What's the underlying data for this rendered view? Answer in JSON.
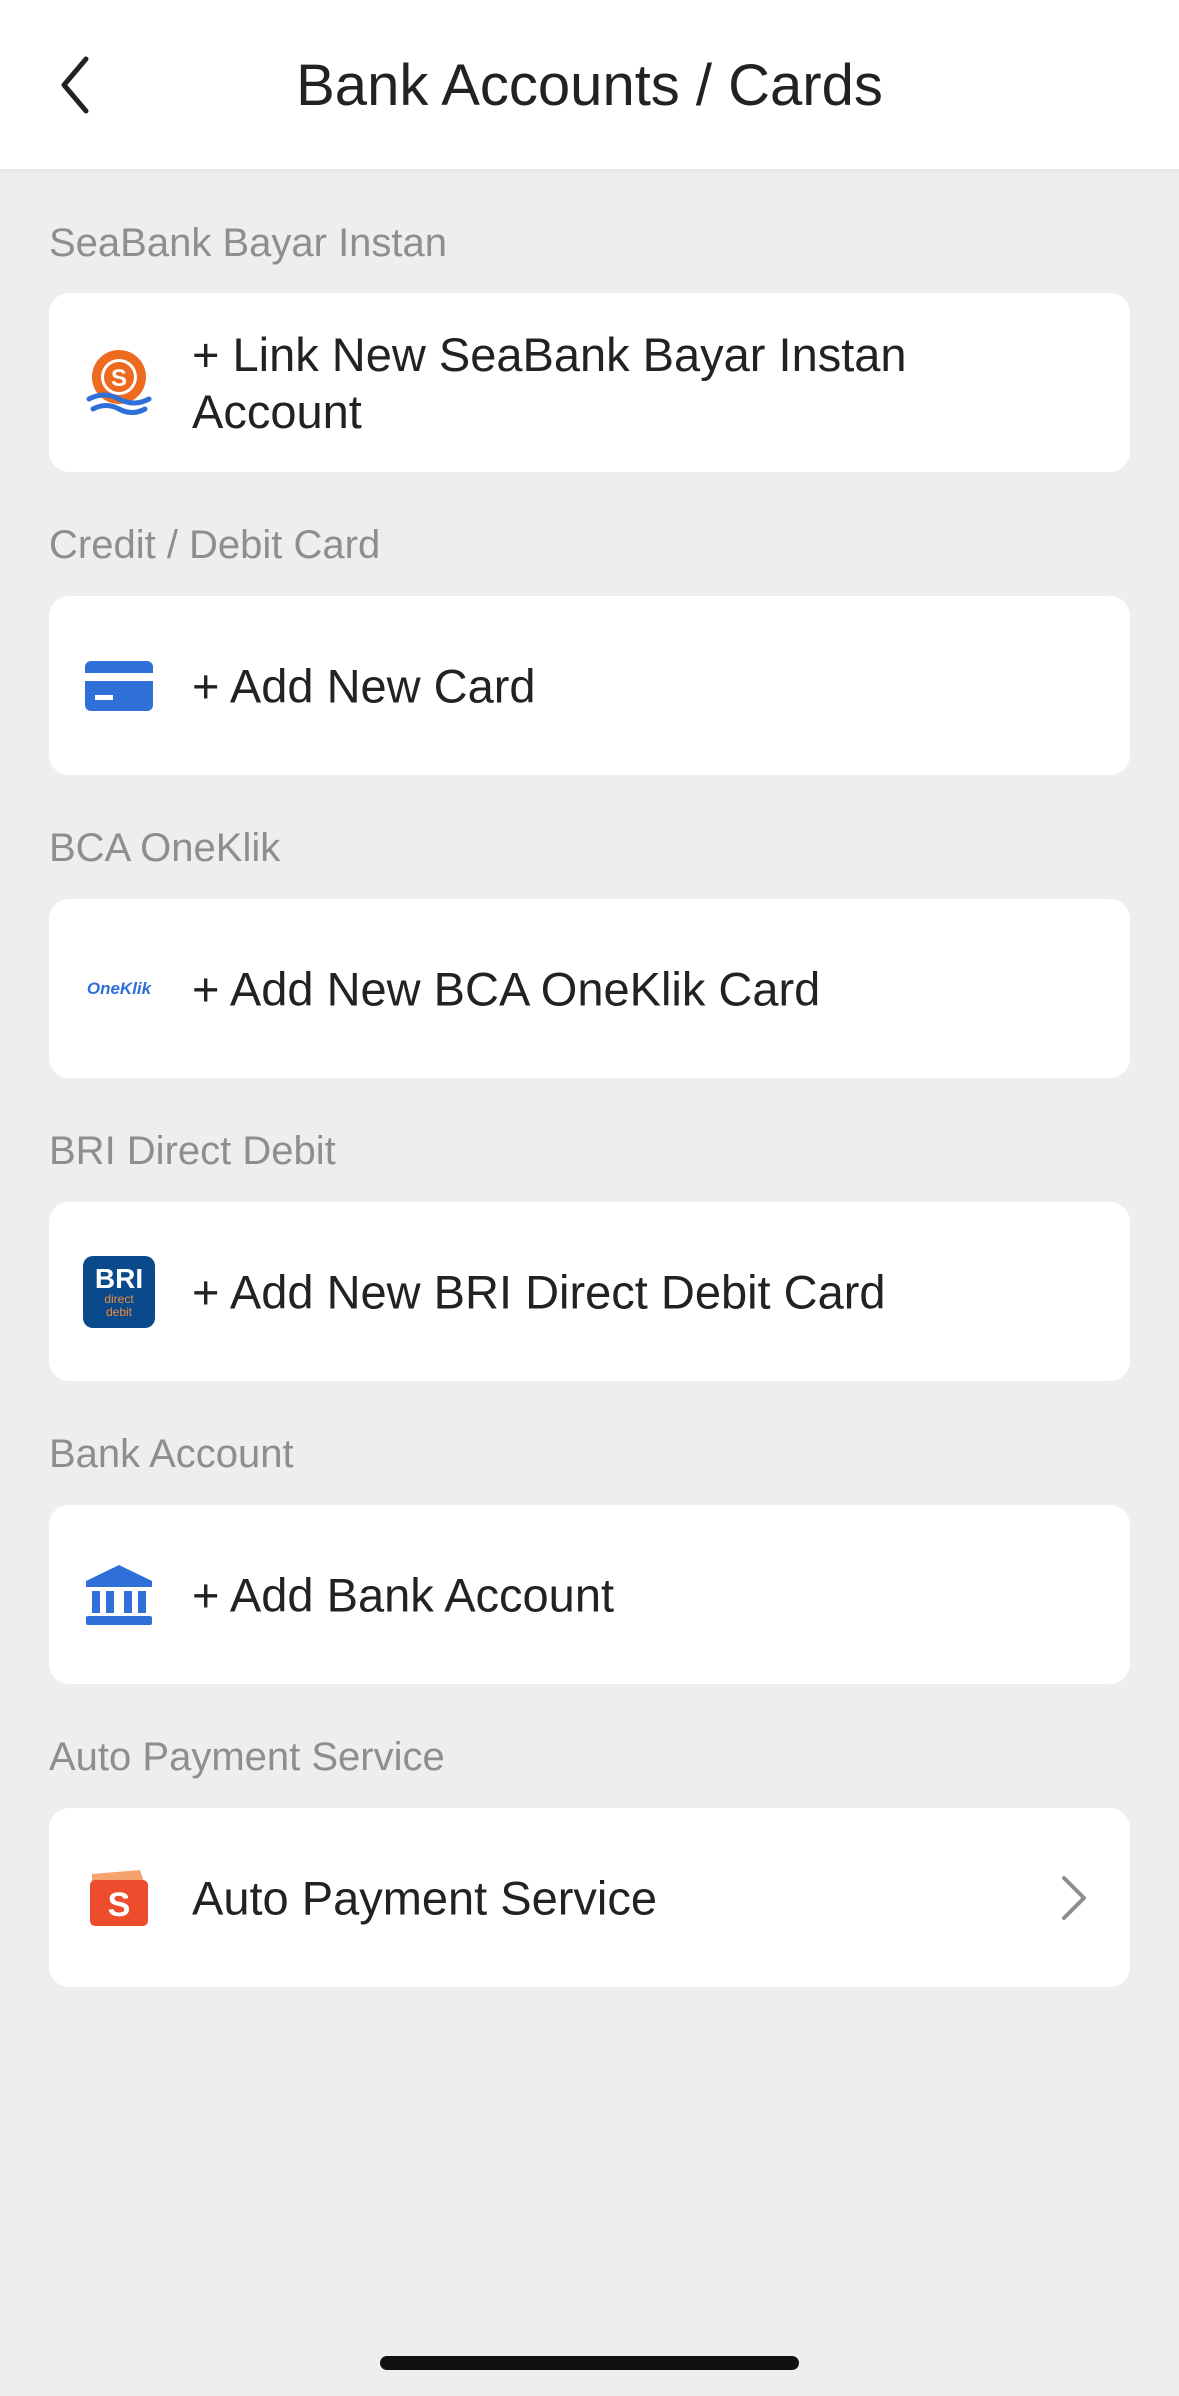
{
  "header": {
    "title": "Bank Accounts / Cards",
    "back_icon": "chevron-left-icon"
  },
  "sections": [
    {
      "label": "SeaBank Bayar Instan",
      "item": {
        "text": "+ Link New SeaBank Bayar Instan Account",
        "icon": "seabank-logo-icon"
      }
    },
    {
      "label": "Credit / Debit Card",
      "item": {
        "text": "+ Add New Card",
        "icon": "credit-card-icon"
      }
    },
    {
      "label": "BCA OneKlik",
      "item": {
        "text": "+ Add New BCA OneKlik Card",
        "icon": "oneklik-logo-icon",
        "icon_text": "OneKlik"
      }
    },
    {
      "label": "BRI Direct Debit",
      "item": {
        "text": "+ Add New BRI Direct Debit Card",
        "icon": "bri-direct-debit-logo-icon",
        "icon_text_1": "BRI",
        "icon_text_2": "direct",
        "icon_text_3": "debit"
      }
    },
    {
      "label": "Bank Account",
      "item": {
        "text": "+ Add Bank Account",
        "icon": "bank-building-icon"
      }
    },
    {
      "label": "Auto Payment Service",
      "item": {
        "text": "Auto Payment Service",
        "icon": "shopee-bag-icon",
        "chevron": "chevron-right-icon"
      }
    }
  ],
  "colors": {
    "background": "#eeeeee",
    "card": "#ffffff",
    "section_label": "#8e8e8e",
    "text": "#222222",
    "blue": "#2f6fd8",
    "seabank_orange": "#ee6a1f",
    "shopee_orange": "#ee4d2d",
    "bri_navy": "#0a4a8c"
  }
}
